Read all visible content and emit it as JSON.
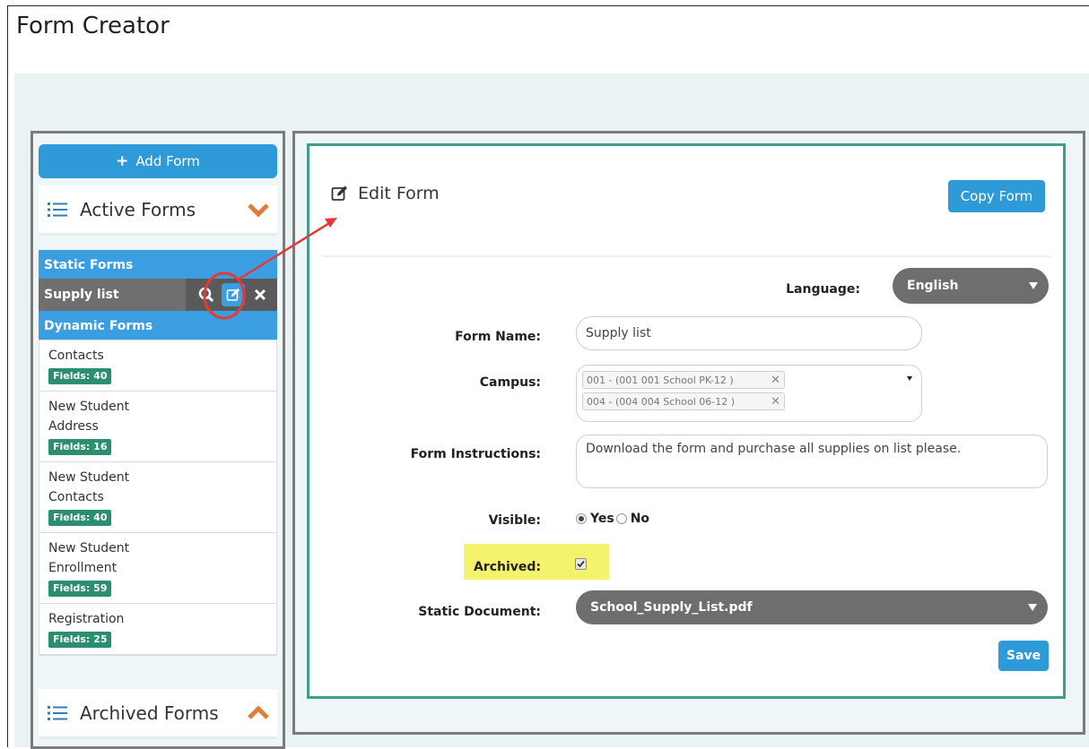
{
  "page_title": "Form Creator",
  "sidebar": {
    "add_form_label": "Add Form",
    "active_forms_label": "Active Forms",
    "archived_forms_label": "Archived Forms",
    "static_forms_label": "Static Forms",
    "dynamic_forms_label": "Dynamic Forms",
    "static_items": [
      {
        "name": "Supply list"
      }
    ],
    "dynamic_items": [
      {
        "name": "Contacts",
        "badge": "Fields: 40"
      },
      {
        "name": "New Student Address",
        "badge": "Fields: 16"
      },
      {
        "name": "New Student Contacts",
        "badge": "Fields: 40"
      },
      {
        "name": "New Student Enrollment",
        "badge": "Fields: 59"
      },
      {
        "name": "Registration",
        "badge": "Fields: 25"
      }
    ]
  },
  "editor": {
    "title": "Edit Form",
    "copy_label": "Copy Form",
    "language_label": "Language:",
    "language_value": "English",
    "form_name_label": "Form Name:",
    "form_name_value": "Supply list",
    "campus_label": "Campus:",
    "campus_tags": [
      "001 - (001 001 School PK-12 )",
      "004 - (004 004 School 06-12 )"
    ],
    "instructions_label": "Form Instructions:",
    "instructions_value": "Download the form and purchase all supplies on list please.",
    "visible_label": "Visible:",
    "visible_yes": "Yes",
    "visible_no": "No",
    "visible_value": "Yes",
    "archived_label": "Archived:",
    "archived_checked": true,
    "static_doc_label": "Static Document:",
    "static_doc_value": "School_Supply_List.pdf",
    "save_label": "Save"
  },
  "colors": {
    "primary": "#2f9ad8",
    "badge": "#2b8f6f",
    "panel_border": "#3e9e8c",
    "highlight": "#f4f36b",
    "chevron": "#e07b39",
    "annotation": "#e53935"
  }
}
